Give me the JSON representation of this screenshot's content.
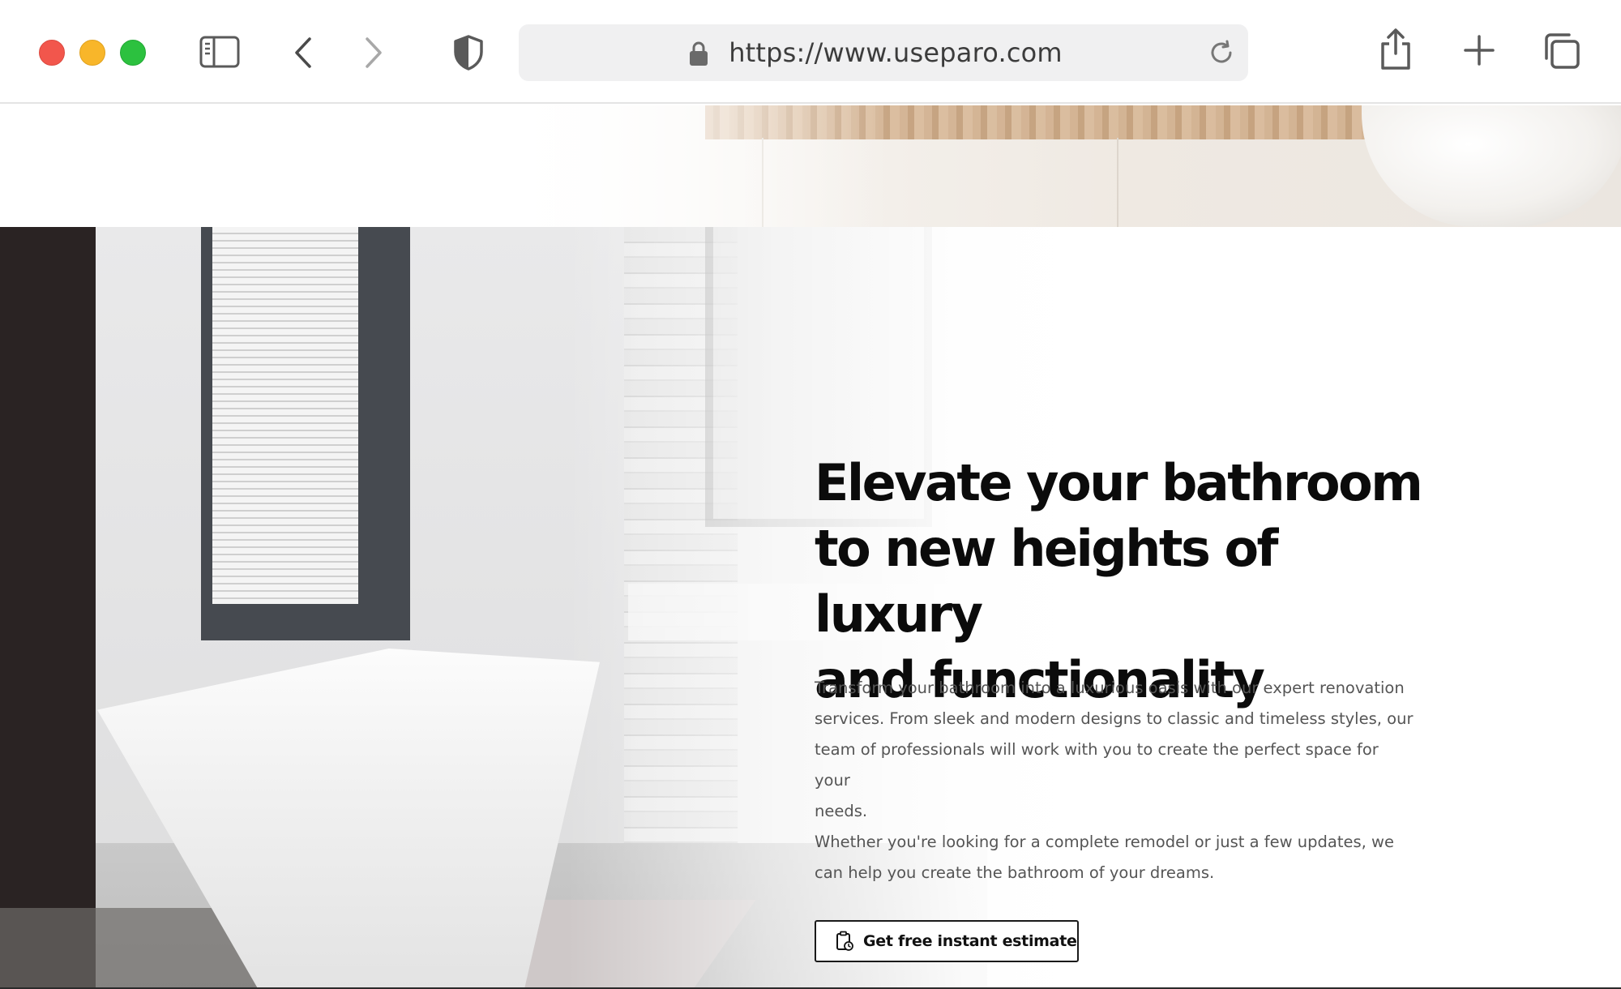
{
  "browser": {
    "url": "https://www.useparo.com"
  },
  "hero": {
    "title_lines": [
      "Elevate your bathroom",
      "to new heights of luxury",
      "and functionality"
    ],
    "paragraph_1_lines": [
      "Transform your bathroom into a luxurious oasis with our expert renovation",
      "services. From sleek and modern designs to classic and timeless styles, our",
      "team of professionals will work with you to create the perfect space for your",
      "needs."
    ],
    "paragraph_2_lines": [
      "Whether you're looking for a complete remodel or just a few updates, we",
      "can help you create the bathroom of your dreams."
    ],
    "cta_label": "Get free instant estimate",
    "cta_icon": "clipboard-clock-icon"
  },
  "colors": {
    "heading": "#0b0b0b",
    "body_text": "#555555",
    "traffic_close": "#f2564c",
    "traffic_minimize": "#f8b62a",
    "traffic_maximize": "#2cc13f"
  }
}
